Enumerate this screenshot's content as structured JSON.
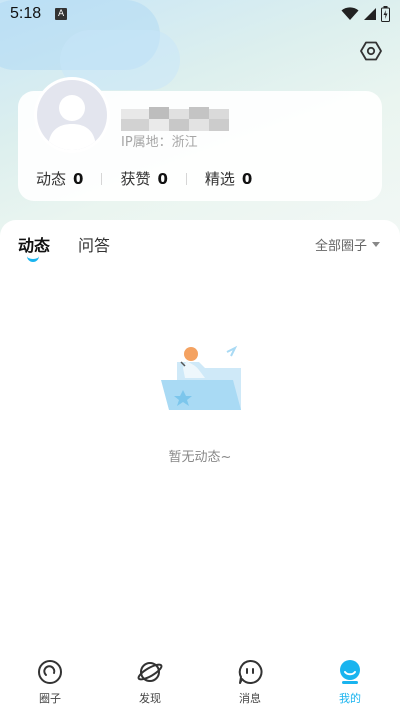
{
  "status_bar": {
    "time": "5:18",
    "notification_badge": "A"
  },
  "profile": {
    "ip_location": "IP属地：浙江",
    "stats": [
      {
        "label": "动态",
        "value": "0"
      },
      {
        "label": "获赞",
        "value": "0"
      },
      {
        "label": "精选",
        "value": "0"
      }
    ]
  },
  "tabs": [
    {
      "label": "动态",
      "active": true
    },
    {
      "label": "问答",
      "active": false
    }
  ],
  "filter": {
    "label": "全部圈子"
  },
  "empty_state": {
    "text": "暂无动态~"
  },
  "bottom_nav": [
    {
      "label": "圈子",
      "icon": "circle-icon",
      "active": false
    },
    {
      "label": "发现",
      "icon": "planet-icon",
      "active": false
    },
    {
      "label": "消息",
      "icon": "message-icon",
      "active": false
    },
    {
      "label": "我的",
      "icon": "profile-icon",
      "active": true
    }
  ],
  "colors": {
    "accent": "#19b4ef",
    "text_muted": "#888888"
  }
}
